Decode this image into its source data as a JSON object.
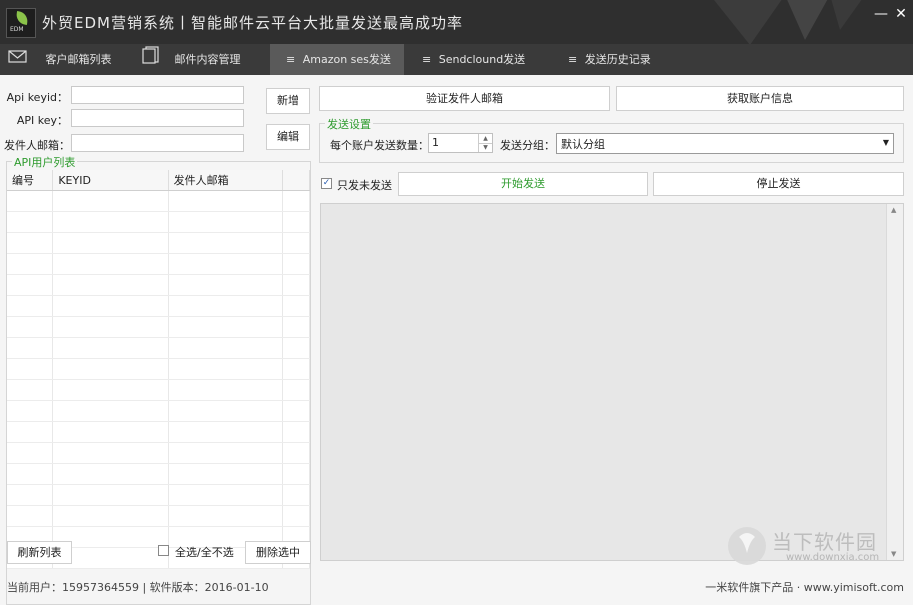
{
  "app": {
    "title": "外贸EDM营销系统丨智能邮件云平台大批量发送最高成功率",
    "logo_text": "EDM",
    "min_label": "—",
    "close_label": "✕"
  },
  "tabs": [
    {
      "label": "客户邮箱列表",
      "icon": "envelope-icon"
    },
    {
      "label": "邮件内容管理",
      "icon": "document-icon"
    },
    {
      "label": "Amazon ses发送",
      "icon": "list-icon"
    },
    {
      "label": "Sendclound发送",
      "icon": "list-icon"
    },
    {
      "label": "发送历史记录",
      "icon": "list-icon"
    }
  ],
  "left": {
    "api_keyid_label": "Api keyid：",
    "api_key_label": "API key：",
    "sender_label": "发件人邮箱：",
    "api_keyid_value": "",
    "api_key_value": "",
    "sender_value": "",
    "add_button": "新增",
    "edit_button": "编辑",
    "list_title": "API用户列表",
    "columns": [
      "编号",
      "KEYID",
      "发件人邮箱"
    ],
    "refresh_button": "刷新列表",
    "select_all_label": "全选/全不选",
    "delete_button": "删除选中"
  },
  "right": {
    "verify_button": "验证发件人邮箱",
    "account_info_button": "获取账户信息",
    "settings_title": "发送设置",
    "per_account_label": "每个账户发送数量：",
    "per_account_value": "1",
    "group_label": "发送分组：",
    "group_value": "默认分组",
    "only_unsent_label": "只发未发送",
    "start_button": "开始发送",
    "stop_button": "停止发送"
  },
  "status": {
    "left_text": "当前用户：15957364559 | 软件版本：2016-01-10",
    "right_text": "一米软件旗下产品 · www.yimisoft.com"
  },
  "watermark": {
    "title": "当下软件园",
    "url": "www.downxia.com"
  },
  "colors": {
    "titlebar": "#2f2f2f",
    "tabbar": "#3a3a3a",
    "tab_active": "#5a5a5a",
    "accent_green": "#2e9b2e",
    "logo_green": "#8bc34a"
  }
}
